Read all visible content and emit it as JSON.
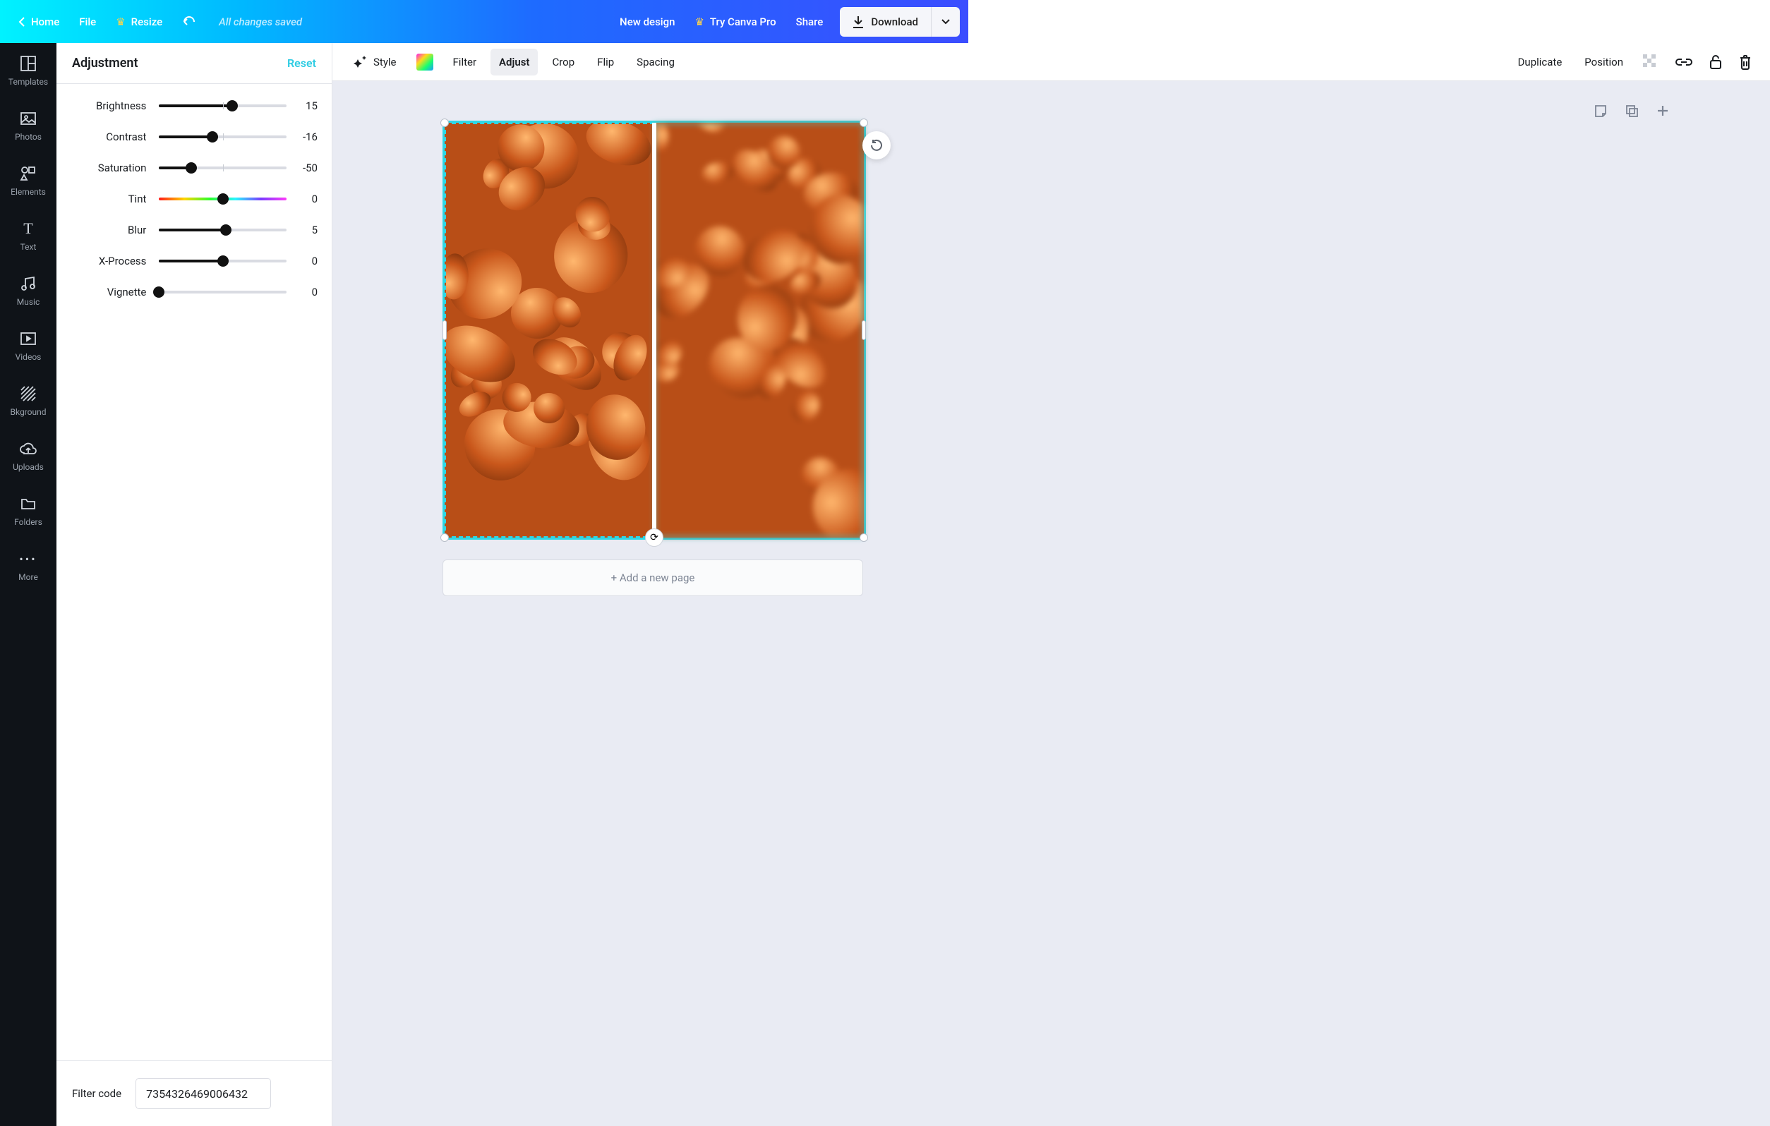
{
  "header": {
    "home": "Home",
    "file": "File",
    "resize": "Resize",
    "status": "All changes saved",
    "new_design": "New design",
    "try_pro": "Try Canva Pro",
    "share": "Share",
    "download": "Download"
  },
  "rail": [
    {
      "label": "Templates"
    },
    {
      "label": "Photos"
    },
    {
      "label": "Elements"
    },
    {
      "label": "Text"
    },
    {
      "label": "Music"
    },
    {
      "label": "Videos"
    },
    {
      "label": "Bkground"
    },
    {
      "label": "Uploads"
    },
    {
      "label": "Folders"
    },
    {
      "label": "More"
    }
  ],
  "panel": {
    "title": "Adjustment",
    "reset": "Reset",
    "filter_code_label": "Filter code",
    "filter_code_value": "7354326469006432"
  },
  "sliders": [
    {
      "label": "Brightness",
      "value": 15,
      "min": -100,
      "max": 100,
      "pos": 57,
      "tick": 50,
      "fill": 57
    },
    {
      "label": "Contrast",
      "value": -16,
      "min": -100,
      "max": 100,
      "pos": 42,
      "tick": 50,
      "fill": 42
    },
    {
      "label": "Saturation",
      "value": -50,
      "min": -100,
      "max": 100,
      "pos": 25,
      "tick": 50,
      "fill": 25
    },
    {
      "label": "Tint",
      "value": 0,
      "min": -100,
      "max": 100,
      "pos": 50,
      "tick": null,
      "tint": true
    },
    {
      "label": "Blur",
      "value": 5,
      "min": -100,
      "max": 100,
      "pos": 52,
      "tick": 50,
      "fill": 52
    },
    {
      "label": "X-Process",
      "value": 0,
      "min": -100,
      "max": 100,
      "pos": 50,
      "tick": 50,
      "fill": 50
    },
    {
      "label": "Vignette",
      "value": 0,
      "min": 0,
      "max": 100,
      "pos": 0,
      "tick": null,
      "fill": 0
    }
  ],
  "context": {
    "style": "Style",
    "filter": "Filter",
    "adjust": "Adjust",
    "crop": "Crop",
    "flip": "Flip",
    "spacing": "Spacing",
    "duplicate": "Duplicate",
    "position": "Position"
  },
  "stage": {
    "add_page": "+ Add a new page"
  }
}
